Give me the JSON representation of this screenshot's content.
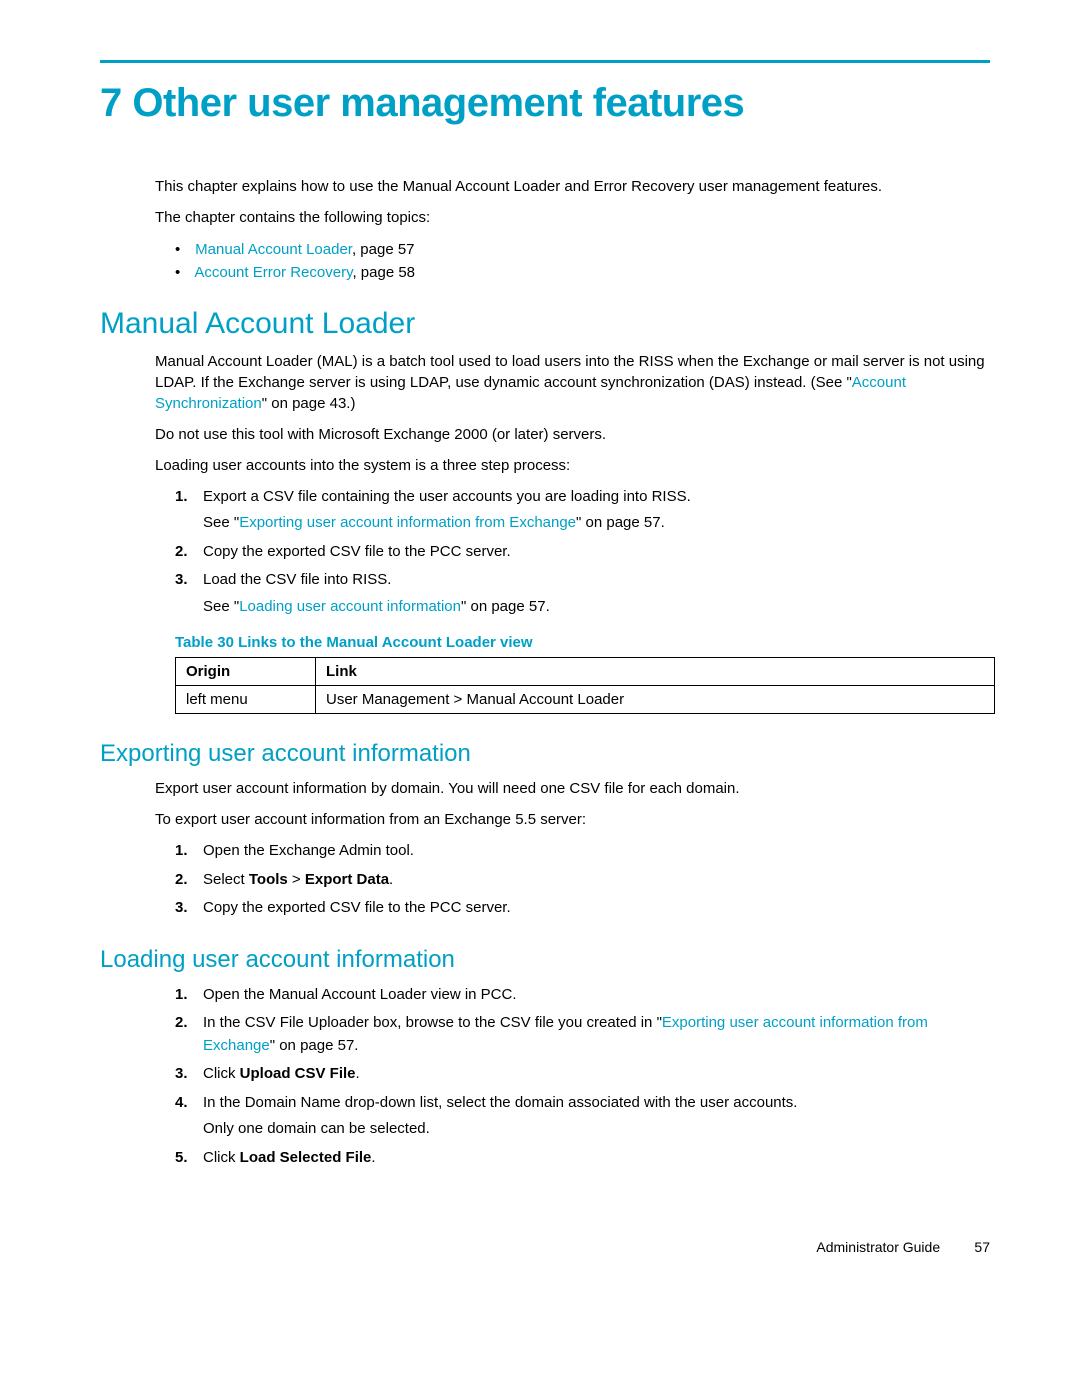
{
  "chapter": {
    "number": "7",
    "title": "Other user management features"
  },
  "intro": {
    "p1": "This chapter explains how to use the Manual Account Loader and Error Recovery user management features.",
    "p2": "The chapter contains the following topics:",
    "toc": [
      {
        "link": "Manual Account Loader",
        "suffix": ", page 57"
      },
      {
        "link": "Account Error Recovery",
        "suffix": ", page 58"
      }
    ]
  },
  "mal": {
    "heading": "Manual Account Loader",
    "p1_a": "Manual Account Loader (MAL) is a batch tool used to load users into the RISS when the Exchange or mail server is not using LDAP. If the Exchange server is using LDAP, use dynamic account synchronization (DAS) instead. (See \"",
    "p1_link": "Account Synchronization",
    "p1_b": "\" on page 43.)",
    "p2": "Do not use this tool with Microsoft Exchange 2000 (or later) servers.",
    "p3": "Loading user accounts into the system is a three step process:",
    "steps": [
      {
        "num": "1.",
        "text": "Export a CSV file containing the user accounts you are loading into RISS.",
        "sec_a": "See \"",
        "sec_link": "Exporting user account information from Exchange",
        "sec_b": "\" on page 57."
      },
      {
        "num": "2.",
        "text": "Copy the exported CSV file to the PCC server."
      },
      {
        "num": "3.",
        "text": "Load the CSV file into RISS.",
        "sec_a": "See \"",
        "sec_link": "Loading user account information",
        "sec_b": "\" on page 57."
      }
    ],
    "table": {
      "title": "Table 30 Links to the Manual Account Loader view",
      "headers": {
        "origin": "Origin",
        "link": "Link"
      },
      "row": {
        "origin": "left menu",
        "link": "User Management > Manual Account Loader"
      }
    }
  },
  "export": {
    "heading": "Exporting user account information",
    "p1": "Export user account information by domain. You will need one CSV file for each domain.",
    "p2": "To export user account information from an Exchange 5.5 server:",
    "steps": [
      {
        "num": "1.",
        "text": "Open the Exchange Admin tool."
      },
      {
        "num": "2.",
        "pre": "Select ",
        "bold1": "Tools",
        "mid": " > ",
        "bold2": "Export Data",
        "post": "."
      },
      {
        "num": "3.",
        "text": "Copy the exported CSV file to the PCC server."
      }
    ]
  },
  "load": {
    "heading": "Loading user account information",
    "steps": [
      {
        "num": "1.",
        "text": "Open the Manual Account Loader view in PCC."
      },
      {
        "num": "2.",
        "pre": "In the CSV File Uploader box, browse to the CSV file you created in \"",
        "link": "Exporting user account information from Exchange",
        "post": "\" on page 57."
      },
      {
        "num": "3.",
        "pre": "Click ",
        "bold": "Upload CSV File",
        "post": "."
      },
      {
        "num": "4.",
        "text": "In the Domain Name drop-down list, select the domain associated with the user accounts.",
        "sec": "Only one domain can be selected."
      },
      {
        "num": "5.",
        "pre": "Click ",
        "bold": "Load Selected File",
        "post": "."
      }
    ]
  },
  "footer": {
    "label": "Administrator Guide",
    "page": "57"
  }
}
